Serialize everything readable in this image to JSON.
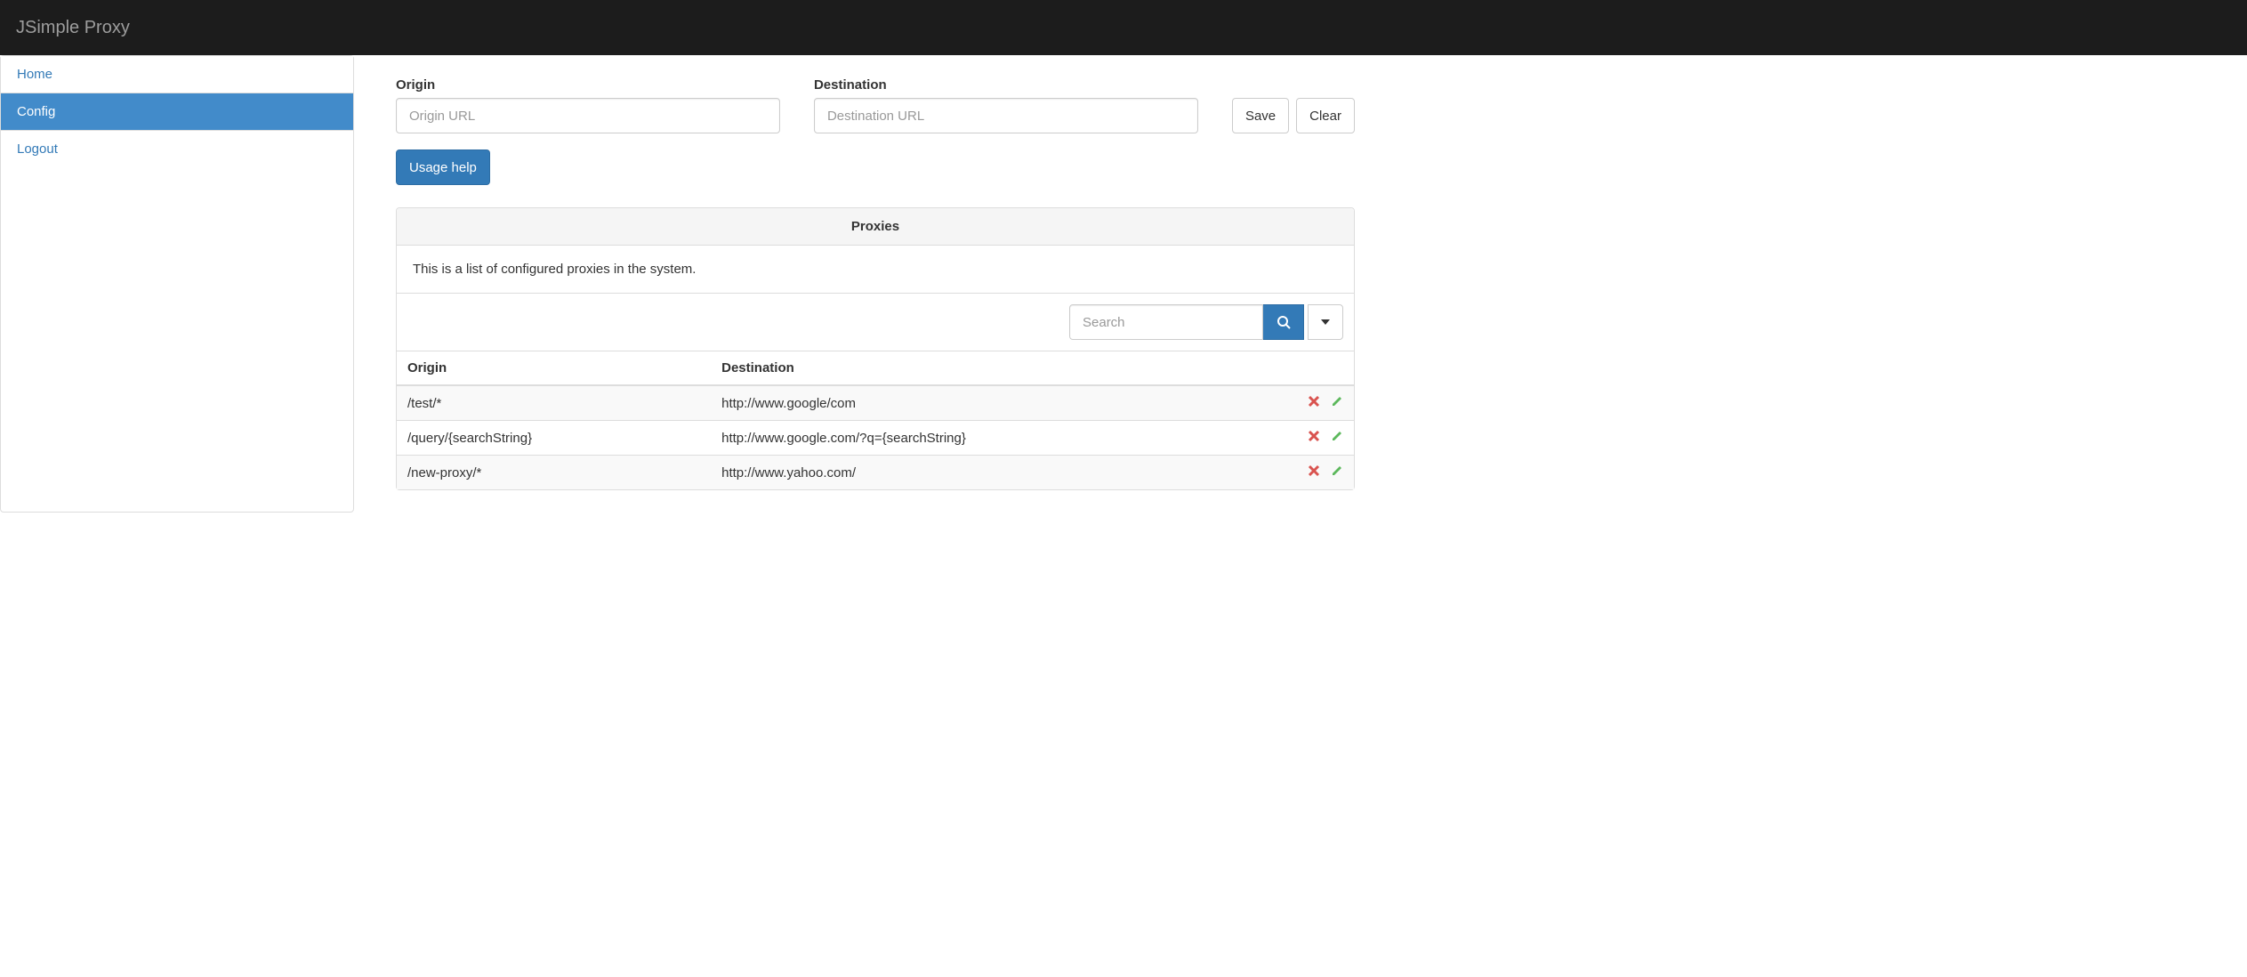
{
  "brand": "JSimple Proxy",
  "sidebar": {
    "items": [
      {
        "label": "Home",
        "active": false
      },
      {
        "label": "Config",
        "active": true
      },
      {
        "label": "Logout",
        "active": false
      }
    ]
  },
  "form": {
    "origin_label": "Origin",
    "origin_placeholder": "Origin URL",
    "destination_label": "Destination",
    "destination_placeholder": "Destination URL",
    "save_label": "Save",
    "clear_label": "Clear",
    "usage_help_label": "Usage help"
  },
  "panel": {
    "title": "Proxies",
    "description": "This is a list of configured proxies in the system.",
    "search_placeholder": "Search",
    "columns": {
      "origin": "Origin",
      "destination": "Destination"
    },
    "rows": [
      {
        "origin": "/test/*",
        "destination": "http://www.google/com"
      },
      {
        "origin": "/query/{searchString}",
        "destination": "http://www.google.com/?q={searchString}"
      },
      {
        "origin": "/new-proxy/*",
        "destination": "http://www.yahoo.com/"
      }
    ]
  }
}
